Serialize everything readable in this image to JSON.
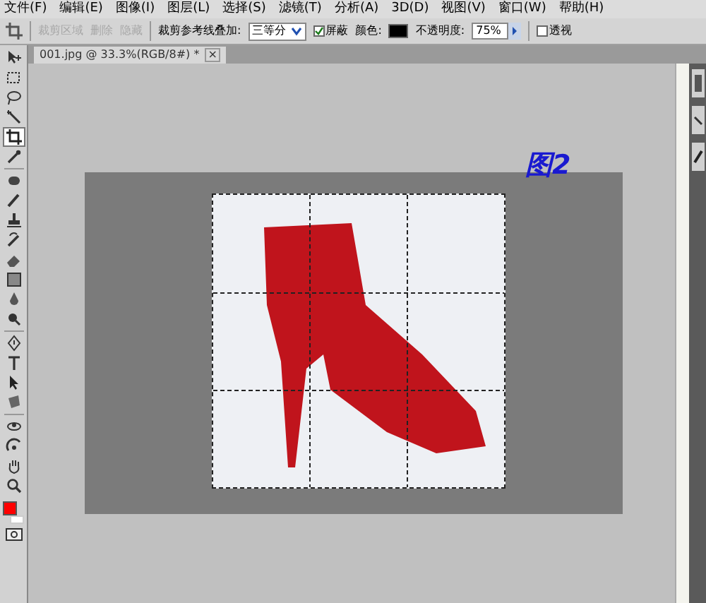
{
  "menu_bar": [
    "文件(F)",
    "编辑(E)",
    "图像(I)",
    "图层(L)",
    "选择(S)",
    "滤镜(T)",
    "分析(A)",
    "3D(D)",
    "视图(V)",
    "窗口(W)",
    "帮助(H)"
  ],
  "options_bar": {
    "crop_area_label": "裁剪区域",
    "delete_option": "删除",
    "hide_option": "隐藏",
    "overlay_label": "裁剪参考线叠加:",
    "overlay_value": "三等分",
    "shield": {
      "label": "屏蔽",
      "checked": true
    },
    "color_label": "颜色:",
    "shield_swatch": {
      "color": "#000000"
    },
    "opacity_label": "不透明度:",
    "opacity_value": "75%",
    "perspective": {
      "label": "透视",
      "checked": false
    }
  },
  "document_tab": {
    "title": "001.jpg @ 33.3%(RGB/8#) *",
    "close": "×"
  },
  "tools": [
    {
      "selected": false
    },
    {
      "selected": false
    },
    {
      "selected": false
    },
    {
      "selected": false
    },
    {
      "selected": true
    },
    {
      "selected": false
    },
    {
      "selected": false
    },
    {
      "selected": false
    },
    {
      "selected": false
    },
    {
      "selected": false
    },
    {
      "selected": false
    },
    {
      "selected": false
    },
    {
      "selected": false
    },
    {
      "selected": false
    },
    {
      "selected": false
    },
    {
      "selected": false
    },
    {
      "selected": false
    },
    {
      "selected": false
    },
    {
      "selected": false
    },
    {
      "selected": false
    },
    {
      "selected": false
    },
    {
      "selected": false
    }
  ],
  "swatches": [
    {
      "kind": "foreground",
      "color": "#ff0000"
    },
    {
      "kind": "background",
      "color": "#ffffff"
    }
  ],
  "annotation": "图2"
}
